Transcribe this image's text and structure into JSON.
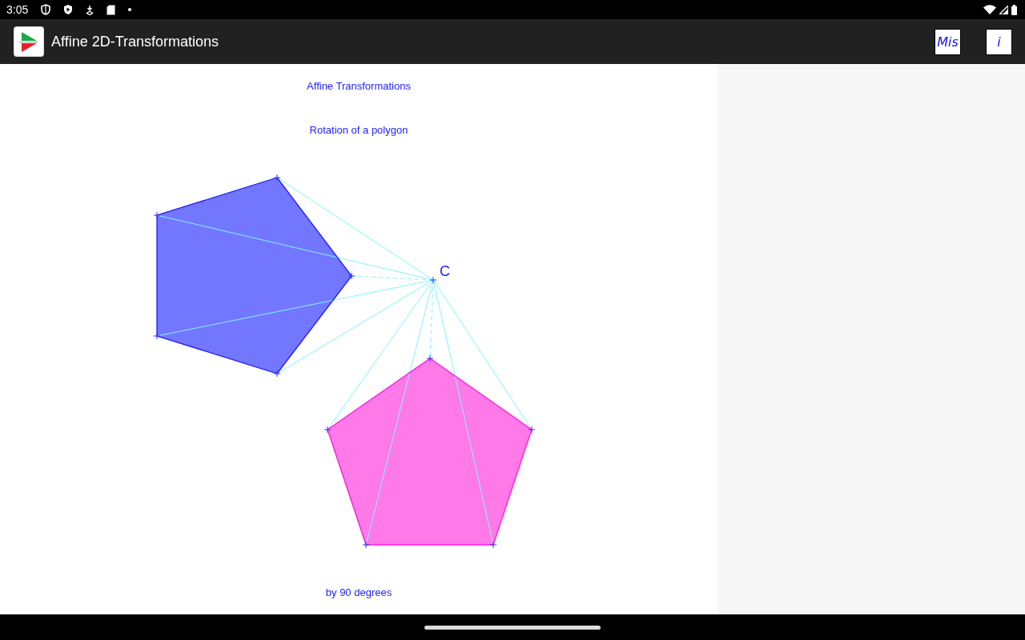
{
  "status_bar": {
    "time": "3:05"
  },
  "app_bar": {
    "title": "Affine 2D-Transformations",
    "actions": [
      {
        "label": "Mis"
      },
      {
        "label": "i"
      }
    ]
  },
  "canvas": {
    "title": "Affine Transformations",
    "subtitle": "Rotation of a polygon",
    "center_label": "C",
    "caption": "by 90 degrees"
  }
}
